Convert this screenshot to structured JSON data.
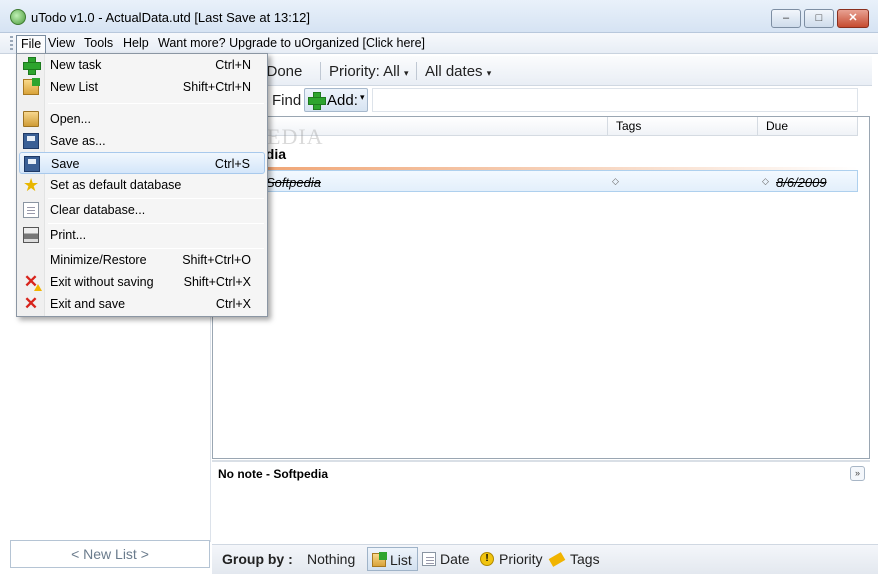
{
  "window": {
    "title": "uTodo v1.0 - ActualData.utd  [Last Save at 13:12]",
    "minimize": "–",
    "maximize": "□",
    "close": "✕"
  },
  "menubar": {
    "items": [
      "File",
      "View",
      "Tools",
      "Help",
      "Want more? Upgrade to uOrganized [Click here]"
    ]
  },
  "toolbar": {
    "hide_done": "e Done",
    "priority": "Priority: All",
    "dates": "All dates",
    "find": "Find",
    "add": "Add:"
  },
  "list": {
    "columns": [
      "Tags",
      "Due"
    ],
    "group_title": "edia",
    "tasks": [
      {
        "name": "Softpedia",
        "tags_marker": "◇",
        "due_marker": "◇",
        "due": "8/6/2009"
      }
    ]
  },
  "note": {
    "title": "No note - Softpedia",
    "toggle": "»"
  },
  "statusbar": {
    "group_by": "Group by :",
    "options": [
      "Nothing",
      "List",
      "Date",
      "Priority",
      "Tags"
    ],
    "selected": "List"
  },
  "left_pane": {
    "new_list": "< New List >"
  },
  "file_menu": {
    "items": [
      {
        "label": "New task",
        "shortcut": "Ctrl+N",
        "icon": "plus-icon"
      },
      {
        "label": "New List",
        "shortcut": "Shift+Ctrl+N",
        "icon": "new-list-icon"
      },
      {
        "label": "Open...",
        "shortcut": "",
        "icon": "folder-icon"
      },
      {
        "label": "Save as...",
        "shortcut": "",
        "icon": "disk-icon"
      },
      {
        "label": "Save",
        "shortcut": "Ctrl+S",
        "icon": "disk-icon"
      },
      {
        "label": "Set as default database",
        "shortcut": "",
        "icon": "star-icon"
      },
      {
        "label": "Clear database...",
        "shortcut": "",
        "icon": "document-icon"
      },
      {
        "label": "Print...",
        "shortcut": "",
        "icon": "printer-icon"
      },
      {
        "label": "Minimize/Restore",
        "shortcut": "Shift+Ctrl+O",
        "icon": ""
      },
      {
        "label": "Exit without saving",
        "shortcut": "Shift+Ctrl+X",
        "icon": "exit-warning-icon"
      },
      {
        "label": "Exit and save",
        "shortcut": "Ctrl+X",
        "icon": "exit-icon"
      }
    ]
  },
  "watermark": "SOFTPEDIA"
}
